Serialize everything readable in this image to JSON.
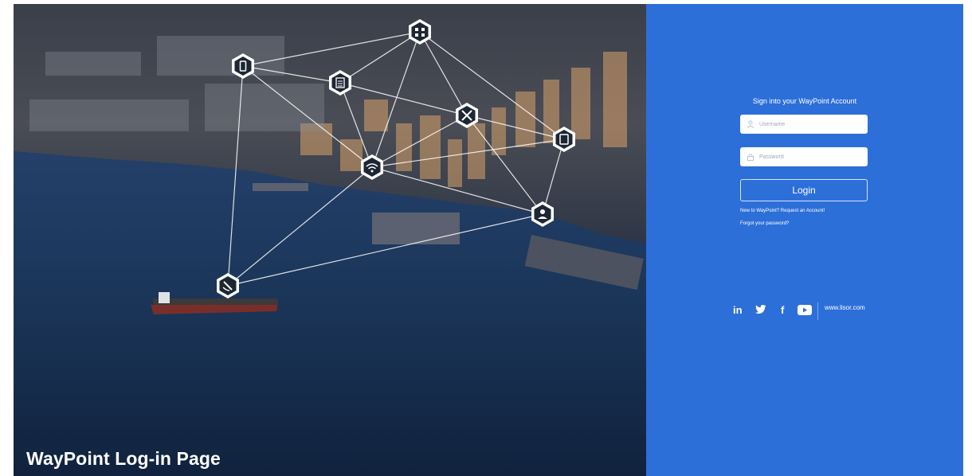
{
  "hero": {
    "title": "WayPoint Log-in Page"
  },
  "login": {
    "heading": "Sign into your WayPoint Account",
    "username_placeholder": "Username",
    "password_placeholder": "Password",
    "login_label": "Login",
    "request_link": "New to WayPoint? Request an Account!",
    "forgot_link": "Forgot your password?"
  },
  "social": {
    "linkedin": "in",
    "facebook": "f",
    "website": "www.lisor.com"
  },
  "colors": {
    "panel_blue": "#2d6fd9",
    "water": "#142a48",
    "white": "#ffffff"
  },
  "network_nodes": [
    {
      "icon": "network-hub-icon"
    },
    {
      "icon": "mobile-phone-icon"
    },
    {
      "icon": "document-icon"
    },
    {
      "icon": "tools-icon"
    },
    {
      "icon": "tablet-icon"
    },
    {
      "icon": "wifi-icon"
    },
    {
      "icon": "worker-icon"
    },
    {
      "icon": "satellite-icon"
    }
  ]
}
